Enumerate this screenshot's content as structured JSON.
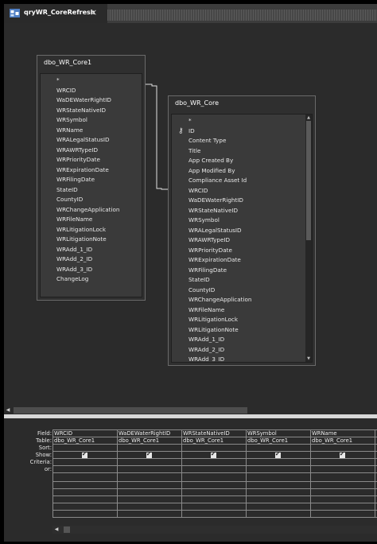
{
  "window": {
    "tab_title": "qryWR_CoreRefresh",
    "close_glyph": "×"
  },
  "left_table": {
    "title": "dbo_WR_Core1",
    "fields": [
      "*",
      "WRCID",
      "WaDEWaterRightID",
      "WRStateNativeID",
      "WRSymbol",
      "WRName",
      "WRALegalStatusID",
      "WRAWRTypeID",
      "WRPriorityDate",
      "WRExpirationDate",
      "WRFilingDate",
      "StateID",
      "CountyID",
      "WRChangeApplication",
      "WRFileName",
      "WRLitigationLock",
      "WRLitigationNote",
      "WRAdd_1_ID",
      "WRAdd_2_ID",
      "WRAdd_3_ID",
      "ChangeLog"
    ]
  },
  "right_table": {
    "title": "dbo_WR_Core",
    "key_icon": "key-icon",
    "fields": [
      "*",
      "ID",
      "Content Type",
      "Title",
      "App Created By",
      "App Modified By",
      "Compliance Asset Id",
      "WRCID",
      "WaDEWaterRightID",
      "WRStateNativeID",
      "WRSymbol",
      "WRALegalStatusID",
      "WRAWRTypeID",
      "WRPriorityDate",
      "WRExpirationDate",
      "WRFilingDate",
      "StateID",
      "CountyID",
      "WRChangeApplication",
      "WRFileName",
      "WRLitigationLock",
      "WRLitigationNote",
      "WRAdd_1_ID",
      "WRAdd_2_ID",
      "WRAdd_3_ID"
    ]
  },
  "grid": {
    "row_labels": [
      "Field:",
      "Table:",
      "Sort:",
      "Show:",
      "Criteria:",
      "or:"
    ],
    "columns": [
      {
        "field": "WRCID",
        "table": "dbo_WR_Core1",
        "show": true
      },
      {
        "field": "WaDEWaterRightID",
        "table": "dbo_WR_Core1",
        "show": true
      },
      {
        "field": "WRStateNativeID",
        "table": "dbo_WR_Core1",
        "show": true
      },
      {
        "field": "WRSymbol",
        "table": "dbo_WR_Core1",
        "show": true
      },
      {
        "field": "WRName",
        "table": "dbo_WR_Core1",
        "show": true
      }
    ]
  },
  "colors": {
    "background": "#2b2b2b",
    "text": "#e8e8e8",
    "table_border": "#6a6a6a"
  }
}
